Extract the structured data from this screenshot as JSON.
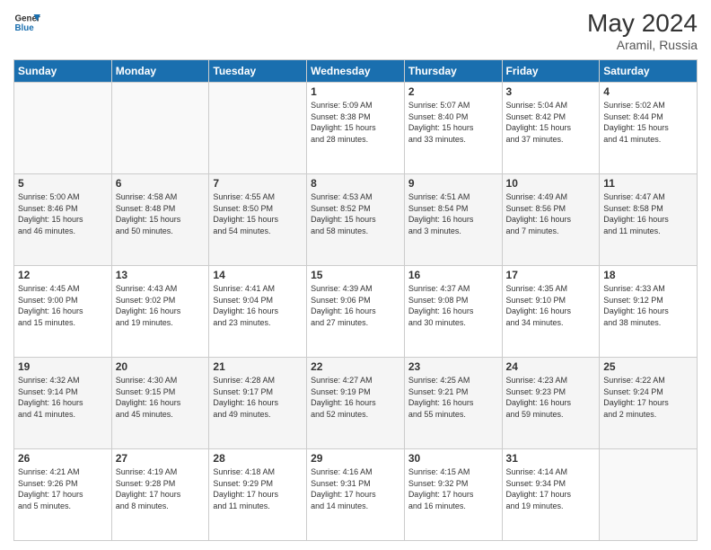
{
  "header": {
    "logo_line1": "General",
    "logo_line2": "Blue",
    "month_year": "May 2024",
    "location": "Aramil, Russia"
  },
  "weekdays": [
    "Sunday",
    "Monday",
    "Tuesday",
    "Wednesday",
    "Thursday",
    "Friday",
    "Saturday"
  ],
  "weeks": [
    [
      {
        "day": "",
        "info": ""
      },
      {
        "day": "",
        "info": ""
      },
      {
        "day": "",
        "info": ""
      },
      {
        "day": "1",
        "info": "Sunrise: 5:09 AM\nSunset: 8:38 PM\nDaylight: 15 hours\nand 28 minutes."
      },
      {
        "day": "2",
        "info": "Sunrise: 5:07 AM\nSunset: 8:40 PM\nDaylight: 15 hours\nand 33 minutes."
      },
      {
        "day": "3",
        "info": "Sunrise: 5:04 AM\nSunset: 8:42 PM\nDaylight: 15 hours\nand 37 minutes."
      },
      {
        "day": "4",
        "info": "Sunrise: 5:02 AM\nSunset: 8:44 PM\nDaylight: 15 hours\nand 41 minutes."
      }
    ],
    [
      {
        "day": "5",
        "info": "Sunrise: 5:00 AM\nSunset: 8:46 PM\nDaylight: 15 hours\nand 46 minutes."
      },
      {
        "day": "6",
        "info": "Sunrise: 4:58 AM\nSunset: 8:48 PM\nDaylight: 15 hours\nand 50 minutes."
      },
      {
        "day": "7",
        "info": "Sunrise: 4:55 AM\nSunset: 8:50 PM\nDaylight: 15 hours\nand 54 minutes."
      },
      {
        "day": "8",
        "info": "Sunrise: 4:53 AM\nSunset: 8:52 PM\nDaylight: 15 hours\nand 58 minutes."
      },
      {
        "day": "9",
        "info": "Sunrise: 4:51 AM\nSunset: 8:54 PM\nDaylight: 16 hours\nand 3 minutes."
      },
      {
        "day": "10",
        "info": "Sunrise: 4:49 AM\nSunset: 8:56 PM\nDaylight: 16 hours\nand 7 minutes."
      },
      {
        "day": "11",
        "info": "Sunrise: 4:47 AM\nSunset: 8:58 PM\nDaylight: 16 hours\nand 11 minutes."
      }
    ],
    [
      {
        "day": "12",
        "info": "Sunrise: 4:45 AM\nSunset: 9:00 PM\nDaylight: 16 hours\nand 15 minutes."
      },
      {
        "day": "13",
        "info": "Sunrise: 4:43 AM\nSunset: 9:02 PM\nDaylight: 16 hours\nand 19 minutes."
      },
      {
        "day": "14",
        "info": "Sunrise: 4:41 AM\nSunset: 9:04 PM\nDaylight: 16 hours\nand 23 minutes."
      },
      {
        "day": "15",
        "info": "Sunrise: 4:39 AM\nSunset: 9:06 PM\nDaylight: 16 hours\nand 27 minutes."
      },
      {
        "day": "16",
        "info": "Sunrise: 4:37 AM\nSunset: 9:08 PM\nDaylight: 16 hours\nand 30 minutes."
      },
      {
        "day": "17",
        "info": "Sunrise: 4:35 AM\nSunset: 9:10 PM\nDaylight: 16 hours\nand 34 minutes."
      },
      {
        "day": "18",
        "info": "Sunrise: 4:33 AM\nSunset: 9:12 PM\nDaylight: 16 hours\nand 38 minutes."
      }
    ],
    [
      {
        "day": "19",
        "info": "Sunrise: 4:32 AM\nSunset: 9:14 PM\nDaylight: 16 hours\nand 41 minutes."
      },
      {
        "day": "20",
        "info": "Sunrise: 4:30 AM\nSunset: 9:15 PM\nDaylight: 16 hours\nand 45 minutes."
      },
      {
        "day": "21",
        "info": "Sunrise: 4:28 AM\nSunset: 9:17 PM\nDaylight: 16 hours\nand 49 minutes."
      },
      {
        "day": "22",
        "info": "Sunrise: 4:27 AM\nSunset: 9:19 PM\nDaylight: 16 hours\nand 52 minutes."
      },
      {
        "day": "23",
        "info": "Sunrise: 4:25 AM\nSunset: 9:21 PM\nDaylight: 16 hours\nand 55 minutes."
      },
      {
        "day": "24",
        "info": "Sunrise: 4:23 AM\nSunset: 9:23 PM\nDaylight: 16 hours\nand 59 minutes."
      },
      {
        "day": "25",
        "info": "Sunrise: 4:22 AM\nSunset: 9:24 PM\nDaylight: 17 hours\nand 2 minutes."
      }
    ],
    [
      {
        "day": "26",
        "info": "Sunrise: 4:21 AM\nSunset: 9:26 PM\nDaylight: 17 hours\nand 5 minutes."
      },
      {
        "day": "27",
        "info": "Sunrise: 4:19 AM\nSunset: 9:28 PM\nDaylight: 17 hours\nand 8 minutes."
      },
      {
        "day": "28",
        "info": "Sunrise: 4:18 AM\nSunset: 9:29 PM\nDaylight: 17 hours\nand 11 minutes."
      },
      {
        "day": "29",
        "info": "Sunrise: 4:16 AM\nSunset: 9:31 PM\nDaylight: 17 hours\nand 14 minutes."
      },
      {
        "day": "30",
        "info": "Sunrise: 4:15 AM\nSunset: 9:32 PM\nDaylight: 17 hours\nand 16 minutes."
      },
      {
        "day": "31",
        "info": "Sunrise: 4:14 AM\nSunset: 9:34 PM\nDaylight: 17 hours\nand 19 minutes."
      },
      {
        "day": "",
        "info": ""
      }
    ]
  ]
}
